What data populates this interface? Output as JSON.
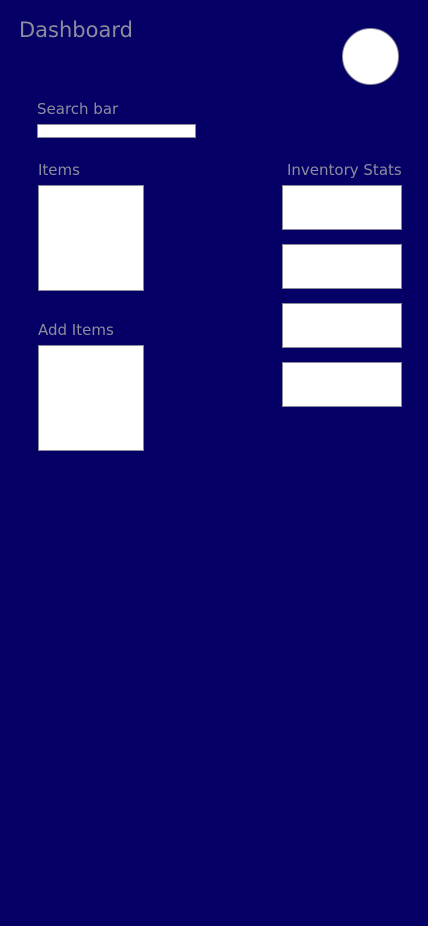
{
  "header": {
    "title": "Dashboard"
  },
  "search": {
    "label": "Search bar",
    "value": "",
    "placeholder": ""
  },
  "items": {
    "label": "Items"
  },
  "add_items": {
    "label": "Add Items"
  },
  "inventory_stats": {
    "label": "Inventory Stats",
    "card_count_visible": 4
  },
  "colors": {
    "background": "#050066",
    "label_text": "#8d8d9e",
    "card": "#ffffff",
    "card_border": "#8a8a9a"
  }
}
